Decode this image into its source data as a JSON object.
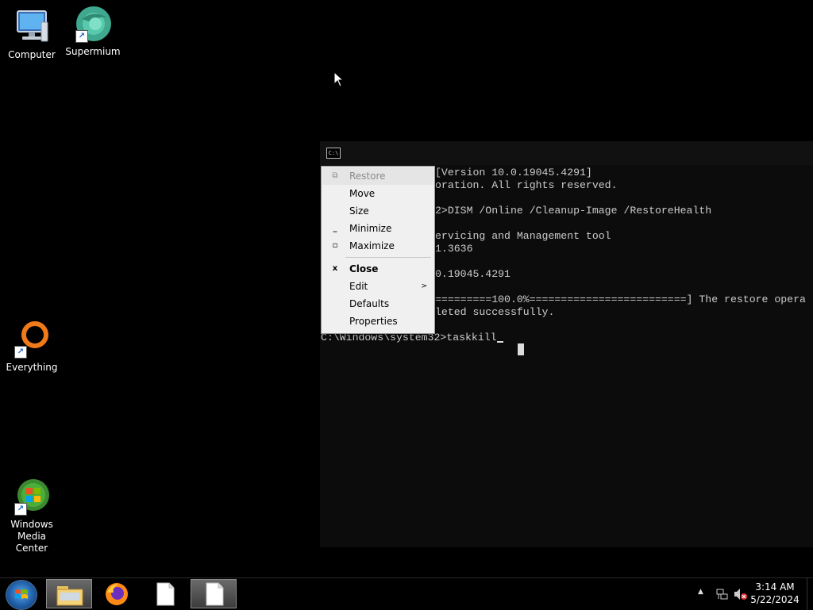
{
  "desktop": {
    "icons": [
      {
        "label": "Computer"
      },
      {
        "label": "Supermium"
      },
      {
        "label": "Everything"
      },
      {
        "label": "Windows\nMedia Center"
      }
    ]
  },
  "console": {
    "lines": [
      "[Version 10.0.19045.4291]",
      "oration. All rights reserved.",
      "2>DISM /Online /Cleanup-Image /RestoreHealth",
      "ervicing and Management tool",
      "1.3636",
      "0.19045.4291",
      "=========100.0%=========================] The restore opera",
      "leted successfully.",
      "C:\\Windows\\system32>taskkill"
    ]
  },
  "system_menu": {
    "items": [
      {
        "label": "Restore",
        "icon": "restore-icon",
        "disabled": true
      },
      {
        "label": "Move"
      },
      {
        "label": "Size"
      },
      {
        "label": "Minimize",
        "icon": "minimize-icon"
      },
      {
        "label": "Maximize",
        "icon": "maximize-icon"
      },
      {
        "label": "Close",
        "icon": "close-icon",
        "bold": true
      },
      {
        "label": "Edit",
        "submenu": true
      },
      {
        "label": "Defaults"
      },
      {
        "label": "Properties"
      }
    ]
  },
  "taskbar": {
    "clock_time": "3:14 AM",
    "clock_date": "5/22/2024"
  }
}
